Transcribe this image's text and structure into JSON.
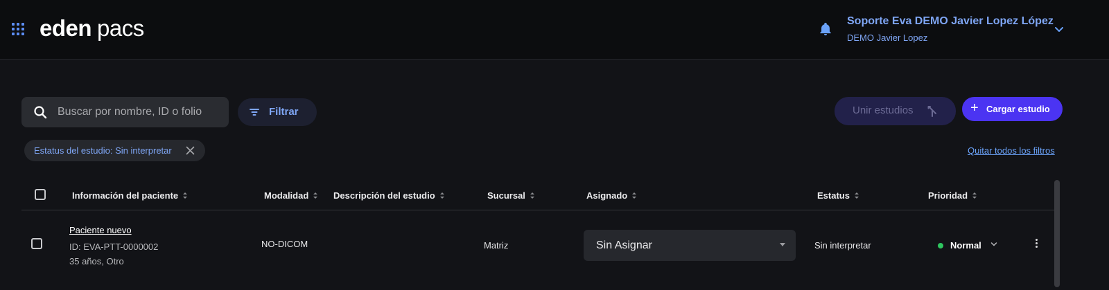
{
  "header": {
    "apps_icon": "grid-icon",
    "logo_word1": "eden",
    "logo_word2": "pacs",
    "notification_icon": "bell-icon",
    "user_name": "Soporte Eva DEMO Javier Lopez López",
    "user_org": "DEMO Javier Lopez"
  },
  "toolbar": {
    "search_placeholder": "Buscar por nombre, ID o folio",
    "search_value": "",
    "filter_label": "Filtrar",
    "merge_label": "Unir estudios",
    "upload_label": "Cargar estudio"
  },
  "filters": {
    "active_chip": "Estatus del estudio: Sin interpretar",
    "clear_all": "Quitar todos los filtros"
  },
  "table": {
    "columns": [
      "Información del paciente",
      "Modalidad",
      "Descripción del estudio",
      "Sucursal",
      "Asignado",
      "Estatus",
      "Prioridad"
    ],
    "rows": [
      {
        "patient_name": "Paciente nuevo",
        "patient_id": "ID: EVA-PTT-0000002",
        "patient_details": "35 años, Otro",
        "modality": "NO-DICOM",
        "description": "",
        "branch": "Matriz",
        "assigned": "Sin Asignar",
        "status": "Sin interpretar",
        "priority": "Normal",
        "priority_color": "#2ec65f"
      }
    ]
  },
  "colors": {
    "background": "#121317",
    "header_bg": "#0c0d0f",
    "accent": "#7fa6f5",
    "primary_button": "#4b34f2"
  }
}
